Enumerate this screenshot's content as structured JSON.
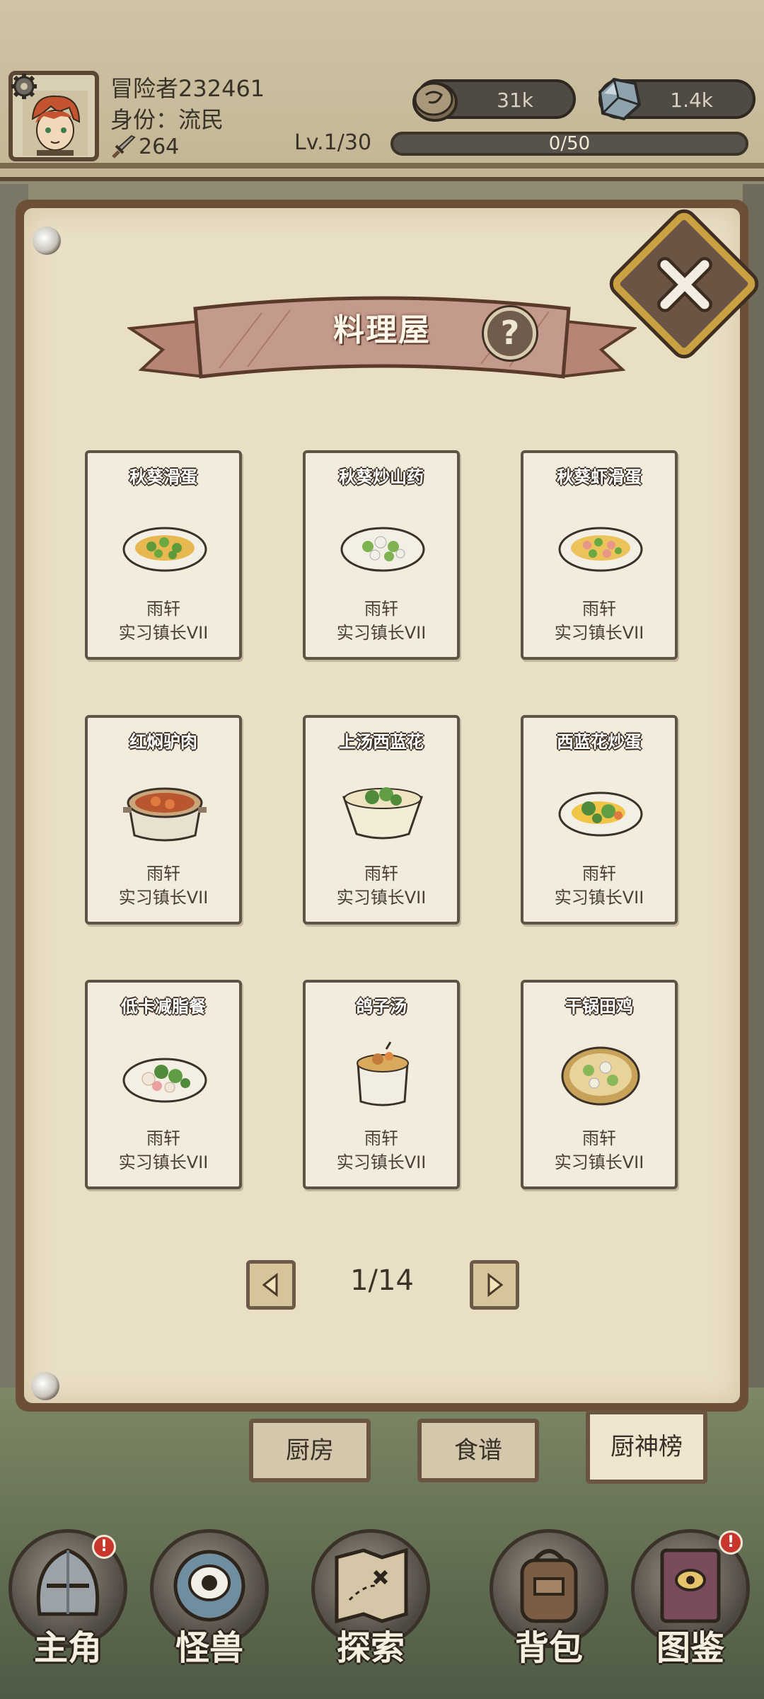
{
  "player": {
    "name": "冒险者232461",
    "rank": "身份：流民",
    "power": "264",
    "level": "Lv.1/30",
    "xp_text": "0/50",
    "xp_fraction": 0.0
  },
  "currencies": {
    "coins": "31k",
    "gems": "1.4k"
  },
  "panel": {
    "title": "料理屋",
    "help_symbol": "?"
  },
  "dishes": [
    {
      "name": "秋葵滑蛋",
      "owner": "雨轩",
      "title": "实习镇长VII"
    },
    {
      "name": "秋葵炒山药",
      "owner": "雨轩",
      "title": "实习镇长VII"
    },
    {
      "name": "秋葵虾滑蛋",
      "owner": "雨轩",
      "title": "实习镇长VII"
    },
    {
      "name": "红焖驴肉",
      "owner": "雨轩",
      "title": "实习镇长VII"
    },
    {
      "name": "上汤西蓝花",
      "owner": "雨轩",
      "title": "实习镇长VII"
    },
    {
      "name": "西蓝花炒蛋",
      "owner": "雨轩",
      "title": "实习镇长VII"
    },
    {
      "name": "低卡减脂餐",
      "owner": "雨轩",
      "title": "实习镇长VII"
    },
    {
      "name": "鸽子汤",
      "owner": "雨轩",
      "title": "实习镇长VII"
    },
    {
      "name": "干锅田鸡",
      "owner": "雨轩",
      "title": "实习镇长VII"
    }
  ],
  "pagination": {
    "label": "1/14"
  },
  "tabs": [
    {
      "label": "厨房"
    },
    {
      "label": "食谱"
    },
    {
      "label": "厨神榜"
    }
  ],
  "nav": [
    {
      "label": "主角",
      "badge": "!"
    },
    {
      "label": "怪兽"
    },
    {
      "label": "探索"
    },
    {
      "label": "背包"
    },
    {
      "label": "图鉴",
      "badge": "!"
    }
  ],
  "colors": {
    "paper": "#e9dfc5",
    "frame": "#6b4f36",
    "ribbon": "#c49a8c",
    "accent_gold": "#caa142",
    "badge_red": "#c9372c"
  }
}
